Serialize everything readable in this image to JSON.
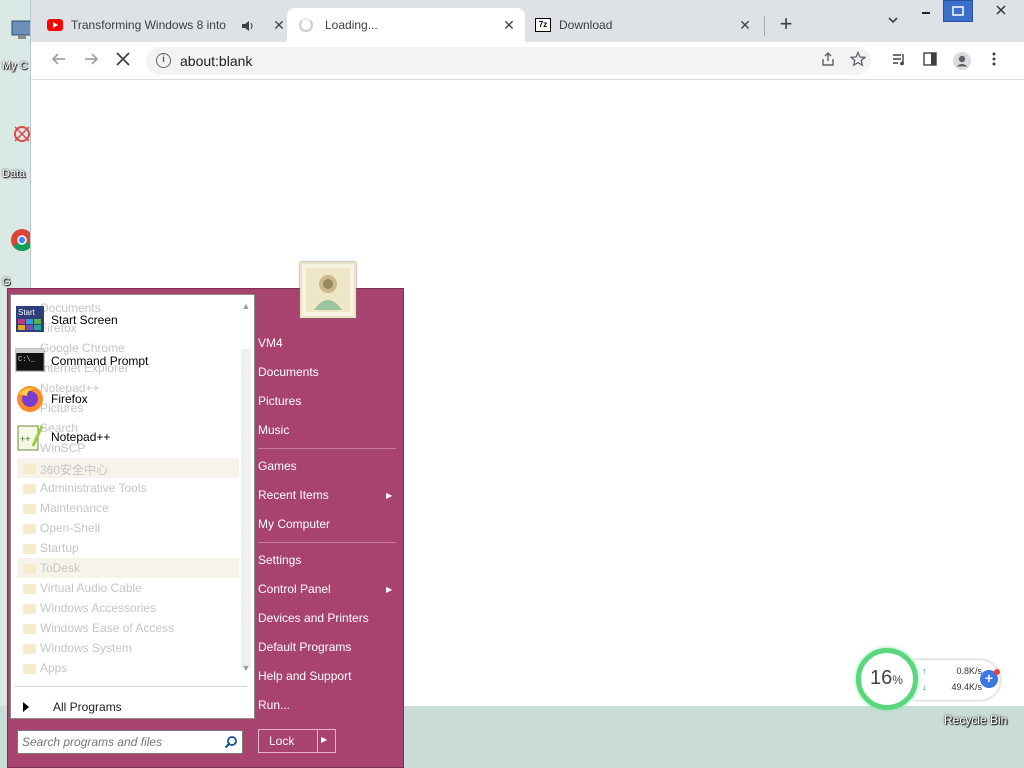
{
  "desktop": {
    "icons": [
      {
        "label": "My C"
      },
      {
        "label": "Data"
      },
      {
        "label": "G"
      }
    ],
    "recycle_bin": "Recycle Bin"
  },
  "browser": {
    "tabs": [
      {
        "title": "Transforming Windows 8 into",
        "icon": "youtube-icon",
        "audio": true
      },
      {
        "title": "Loading...",
        "icon": "loading-spinner",
        "active": true
      },
      {
        "title": "Download",
        "icon": "7zip-icon"
      }
    ],
    "url": "about:blank"
  },
  "start_menu": {
    "pinned": [
      {
        "label": "Start Screen",
        "icon": "start-screen-icon"
      },
      {
        "label": "Command Prompt",
        "icon": "command-prompt-icon"
      },
      {
        "label": "Firefox",
        "icon": "firefox-icon"
      },
      {
        "label": "Notepad++",
        "icon": "notepad-plus-plus-icon"
      }
    ],
    "ghost_items": [
      "Documents",
      "Firefox",
      "Google Chrome",
      "Internet Explorer",
      "Notepad++",
      "Pictures",
      "Search",
      "WinSCP",
      "360安全中心",
      "Administrative Tools",
      "Maintenance",
      "Open-Shell",
      "Startup",
      "ToDesk",
      "Virtual Audio Cable",
      "Windows Accessories",
      "Windows Ease of Access",
      "Windows System",
      "Apps"
    ],
    "all_programs": "All Programs",
    "search_placeholder": "Search programs and files",
    "right_items": [
      "VM4",
      "Documents",
      "Pictures",
      "Music",
      "Games",
      "Recent Items",
      "My Computer",
      "Settings",
      "Control Panel",
      "Devices and Printers",
      "Default Programs",
      "Help and Support",
      "Run..."
    ],
    "lock_label": "Lock"
  },
  "net_widget": {
    "cpu_percent": "16",
    "cpu_unit": "%",
    "upload": "0.8K/s",
    "download": "49.4K/s"
  },
  "colors": {
    "start_menu_bg": "#a8426f",
    "cpu_ring": "#59d67e"
  }
}
